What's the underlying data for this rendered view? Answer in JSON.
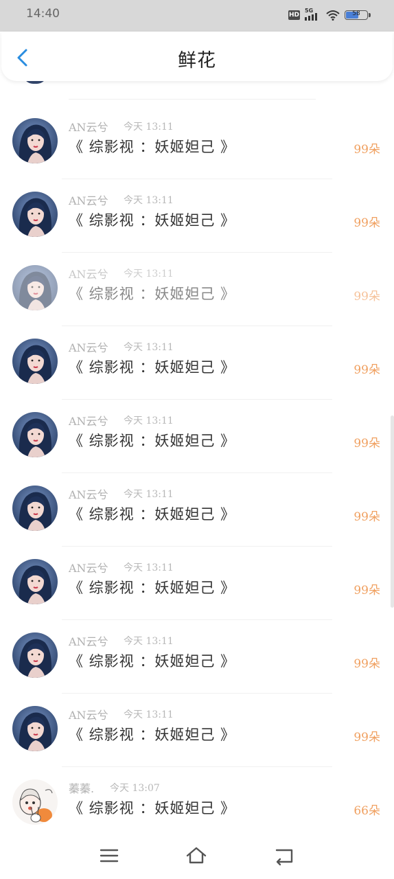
{
  "status_bar": {
    "time": "14:40",
    "hd_label": "HD",
    "network": "5G",
    "battery": "58",
    "icons": [
      "hd-icon",
      "signal-icon",
      "wifi-icon",
      "battery-icon"
    ]
  },
  "header": {
    "title": "鲜花",
    "back_icon": "chevron-left-icon"
  },
  "records": [
    {
      "user": "AN云兮",
      "time": "今天 13:11",
      "work": "《 综影视 ：妖姬妲己 》",
      "count": "99朵",
      "avatar": "woman-portrait",
      "faded": false
    },
    {
      "user": "AN云兮",
      "time": "今天 13:11",
      "work": "《 综影视 ：妖姬妲己 》",
      "count": "99朵",
      "avatar": "woman-portrait",
      "faded": false
    },
    {
      "user": "AN云兮",
      "time": "今天 13:11",
      "work": "《 综影视 ：妖姬妲己 》",
      "count": "99朵",
      "avatar": "woman-portrait",
      "faded": true
    },
    {
      "user": "AN云兮",
      "time": "今天 13:11",
      "work": "《 综影视 ：妖姬妲己 》",
      "count": "99朵",
      "avatar": "woman-portrait",
      "faded": false
    },
    {
      "user": "AN云兮",
      "time": "今天 13:11",
      "work": "《 综影视 ：妖姬妲己 》",
      "count": "99朵",
      "avatar": "woman-portrait",
      "faded": false
    },
    {
      "user": "AN云兮",
      "time": "今天 13:11",
      "work": "《 综影视 ：妖姬妲己 》",
      "count": "99朵",
      "avatar": "woman-portrait",
      "faded": false
    },
    {
      "user": "AN云兮",
      "time": "今天 13:11",
      "work": "《 综影视 ：妖姬妲己 》",
      "count": "99朵",
      "avatar": "woman-portrait",
      "faded": false
    },
    {
      "user": "AN云兮",
      "time": "今天 13:11",
      "work": "《 综影视 ：妖姬妲己 》",
      "count": "99朵",
      "avatar": "woman-portrait",
      "faded": false
    },
    {
      "user": "AN云兮",
      "time": "今天 13:11",
      "work": "《 综影视 ：妖姬妲己 》",
      "count": "99朵",
      "avatar": "woman-portrait",
      "faded": false
    },
    {
      "user": "蓁蓁.",
      "time": "今天 13:07",
      "work": "《 综影视 ：妖姬妲己 》",
      "count": "66朵",
      "avatar": "cartoon-girl-bunny",
      "faded": false
    }
  ],
  "nav": {
    "menu_icon": "menu-icon",
    "home_icon": "home-icon",
    "back_icon": "back-icon"
  },
  "colors": {
    "accent": "#2a8de0",
    "count": "#f0a060",
    "muted_text": "#b0b0b0",
    "status_bar_bg": "#d8d8d8"
  }
}
